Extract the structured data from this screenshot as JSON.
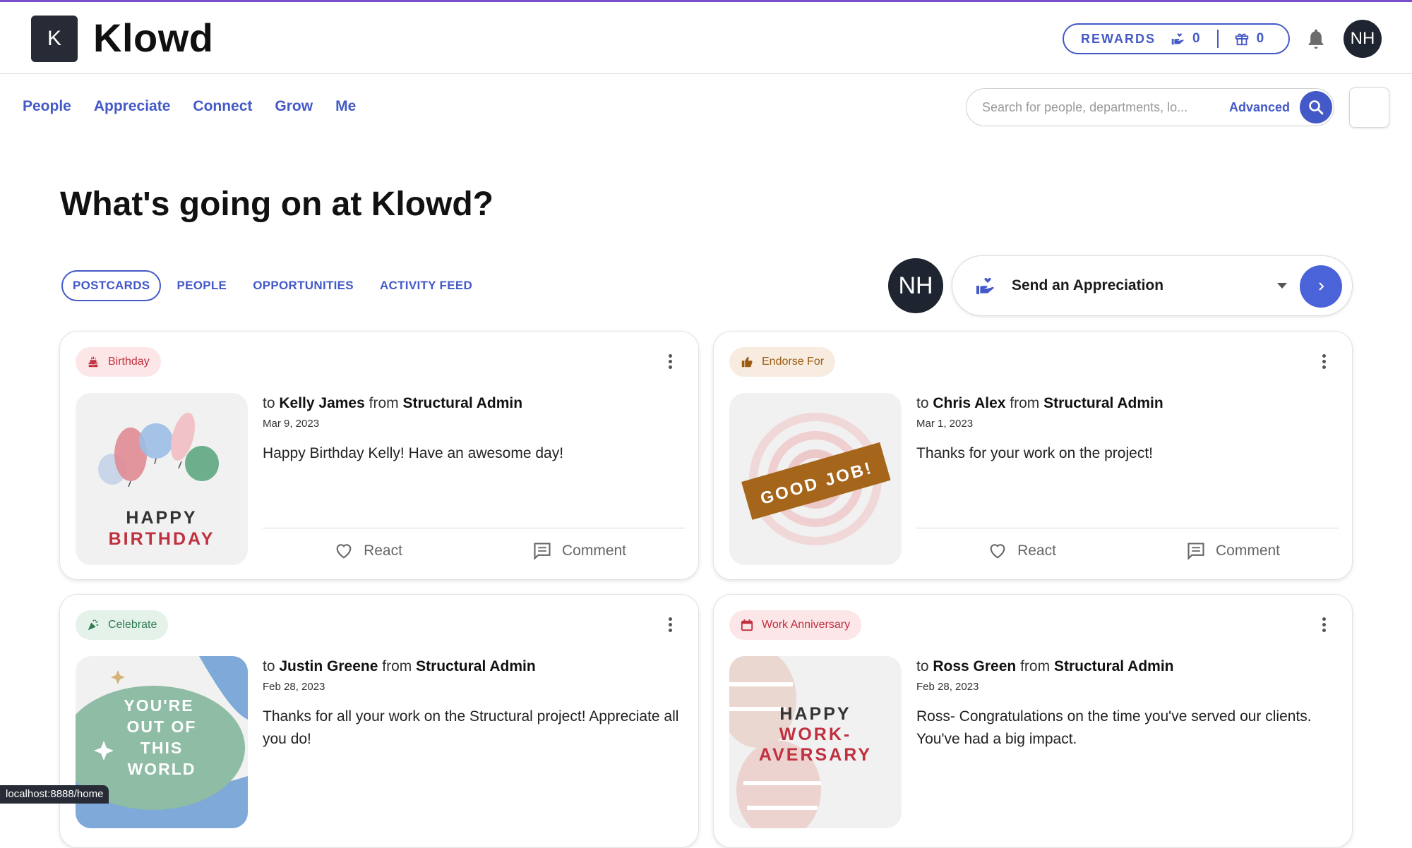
{
  "app": {
    "logo_letter": "K",
    "name": "Klowd"
  },
  "rewards": {
    "label": "REWARDS",
    "points": "0",
    "gifts": "0"
  },
  "user": {
    "initials": "NH"
  },
  "nav": {
    "items": [
      "People",
      "Appreciate",
      "Connect",
      "Grow",
      "Me"
    ]
  },
  "search": {
    "placeholder": "Search for people, departments, lo...",
    "advanced_label": "Advanced"
  },
  "page": {
    "title": "What's going on at Klowd?"
  },
  "tabs": [
    "POSTCARDS",
    "PEOPLE",
    "OPPORTUNITIES",
    "ACTIVITY FEED"
  ],
  "send": {
    "label": "Send an Appreciation"
  },
  "colors": {
    "accent": "#4359c7",
    "dark": "#262b35"
  },
  "postcards": [
    {
      "tag": "Birthday",
      "tag_icon": "cake-icon",
      "to_prefix": "to",
      "to": "Kelly James",
      "from_prefix": "from",
      "from": "Structural Admin",
      "date": "Mar 9, 2023",
      "message": "Happy Birthday Kelly! Have an awesome day!",
      "image_text": [
        "HAPPY",
        "BIRTHDAY"
      ],
      "react_label": "React",
      "comment_label": "Comment"
    },
    {
      "tag": "Endorse For",
      "tag_icon": "thumbs-up-icon",
      "to_prefix": "to",
      "to": "Chris Alex",
      "from_prefix": "from",
      "from": "Structural Admin",
      "date": "Mar 1, 2023",
      "message": "Thanks for your work on the project!",
      "image_text": [
        "GOOD JOB!"
      ],
      "react_label": "React",
      "comment_label": "Comment"
    },
    {
      "tag": "Celebrate",
      "tag_icon": "party-popper-icon",
      "to_prefix": "to",
      "to": "Justin Greene",
      "from_prefix": "from",
      "from": "Structural Admin",
      "date": "Feb 28, 2023",
      "message": "Thanks for all your work on the Structural project! Appreciate all you do!",
      "image_text": [
        "YOU'RE",
        "OUT OF",
        "THIS",
        "WORLD"
      ],
      "react_label": "React",
      "comment_label": "Comment"
    },
    {
      "tag": "Work Anniversary",
      "tag_icon": "calendar-icon",
      "to_prefix": "to",
      "to": "Ross Green",
      "from_prefix": "from",
      "from": "Structural Admin",
      "date": "Feb 28, 2023",
      "message": "Ross- Congratulations on the time you've served our clients. You've had a big impact.",
      "image_text": [
        "HAPPY",
        "WORK-",
        "AVERSARY"
      ],
      "react_label": "React",
      "comment_label": "Comment"
    }
  ],
  "status_url": "localhost:8888/home"
}
